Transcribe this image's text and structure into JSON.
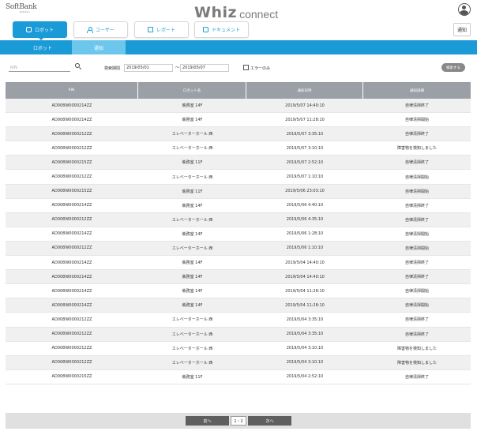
{
  "header": {
    "brand_name": "SoftBank",
    "brand_sub": "Robotics",
    "logo_main": "Whiz",
    "logo_sub": "connect"
  },
  "nav": {
    "tabs": [
      {
        "label": "ロボット",
        "icon": "robot-icon"
      },
      {
        "label": "ユーザー",
        "icon": "user-icon"
      },
      {
        "label": "レポート",
        "icon": "report-icon"
      },
      {
        "label": "ドキュメント",
        "icon": "document-icon"
      }
    ],
    "notify_label": "通知"
  },
  "subnav": {
    "items": [
      "ロボット",
      "通知"
    ]
  },
  "filters": {
    "rin_placeholder": "RIN",
    "period_label": "検索期間",
    "date_from": "2019/05/01",
    "date_to": "2019/05/07",
    "tilde": "～",
    "error_only_label": "エラーのみ",
    "search_label": "検索する"
  },
  "table": {
    "headers": [
      "RIN",
      "ロボット名",
      "通知日時",
      "通知詳細"
    ],
    "rows": [
      [
        "AD008W0000214ZZ",
        "執務室 14F",
        "2019/5/07 14:40:10",
        "自律清掃終了"
      ],
      [
        "AD008W0000214ZZ",
        "執務室 14F",
        "2019/5/07 11:28:10",
        "自律清掃開始"
      ],
      [
        "AD008W0000212ZZ",
        "エレベーターホール 西",
        "2019/5/07 3:35:10",
        "自律清掃終了"
      ],
      [
        "AD008W0000212ZZ",
        "エレベーターホール 西",
        "2019/5/07 3:10:10",
        "障害物を検知しました"
      ],
      [
        "AD008W0000215ZZ",
        "執務室 11F",
        "2019/5/07 2:52:10",
        "自律清掃終了"
      ],
      [
        "AD008W0000212ZZ",
        "エレベーターホール 西",
        "2019/5/07 1:10:10",
        "自律清掃開始"
      ],
      [
        "AD008W0000215ZZ",
        "執務室 11F",
        "2019/5/06 23:03:10",
        "自律清掃開始"
      ],
      [
        "AD008W0000214ZZ",
        "執務室 14F",
        "2019/5/06 4:40:10",
        "自律清掃終了"
      ],
      [
        "AD008W0000212ZZ",
        "エレベーターホール 西",
        "2019/5/06 4:35:10",
        "自律清掃終了"
      ],
      [
        "AD008W0000214ZZ",
        "執務室 14F",
        "2019/5/06 1:28:10",
        "自律清掃開始"
      ],
      [
        "AD008W0000212ZZ",
        "エレベーターホール 西",
        "2019/5/06 1:10:10",
        "自律清掃開始"
      ],
      [
        "AD008W0000214ZZ",
        "執務室 14F",
        "2019/5/04 14:40:10",
        "自律清掃終了"
      ],
      [
        "AD008W0000214ZZ",
        "執務室 14F",
        "2019/5/04 14:40:10",
        "自律清掃終了"
      ],
      [
        "AD008W0000214ZZ",
        "執務室 14F",
        "2019/5/04 11:28:10",
        "自律清掃開始"
      ],
      [
        "AD008W0000214ZZ",
        "執務室 14F",
        "2019/5/04 11:28:10",
        "自律清掃開始"
      ],
      [
        "AD008W0000212ZZ",
        "エレベーターホール 西",
        "2019/5/04 3:35:10",
        "自律清掃終了"
      ],
      [
        "AD008W0000212ZZ",
        "エレベーターホール 西",
        "2019/5/04 3:35:10",
        "自律清掃終了"
      ],
      [
        "AD008W0000212ZZ",
        "エレベーターホール 西",
        "2019/5/04 3:10:10",
        "障害物を検知しました"
      ],
      [
        "AD008W0000212ZZ",
        "エレベーターホール 西",
        "2019/5/04 3:10:10",
        "障害物を検知しました"
      ],
      [
        "AD008W0000215ZZ",
        "執務室 11F",
        "2019/5/04 2:52:10",
        "自律清掃終了"
      ]
    ]
  },
  "pagination": {
    "prev_label": "前へ",
    "page_label": "1・2",
    "next_label": "次へ"
  },
  "colors": {
    "accent": "#1a9ad6",
    "accent_light": "#6dc6ec",
    "header_gray": "#9aa0a6"
  }
}
